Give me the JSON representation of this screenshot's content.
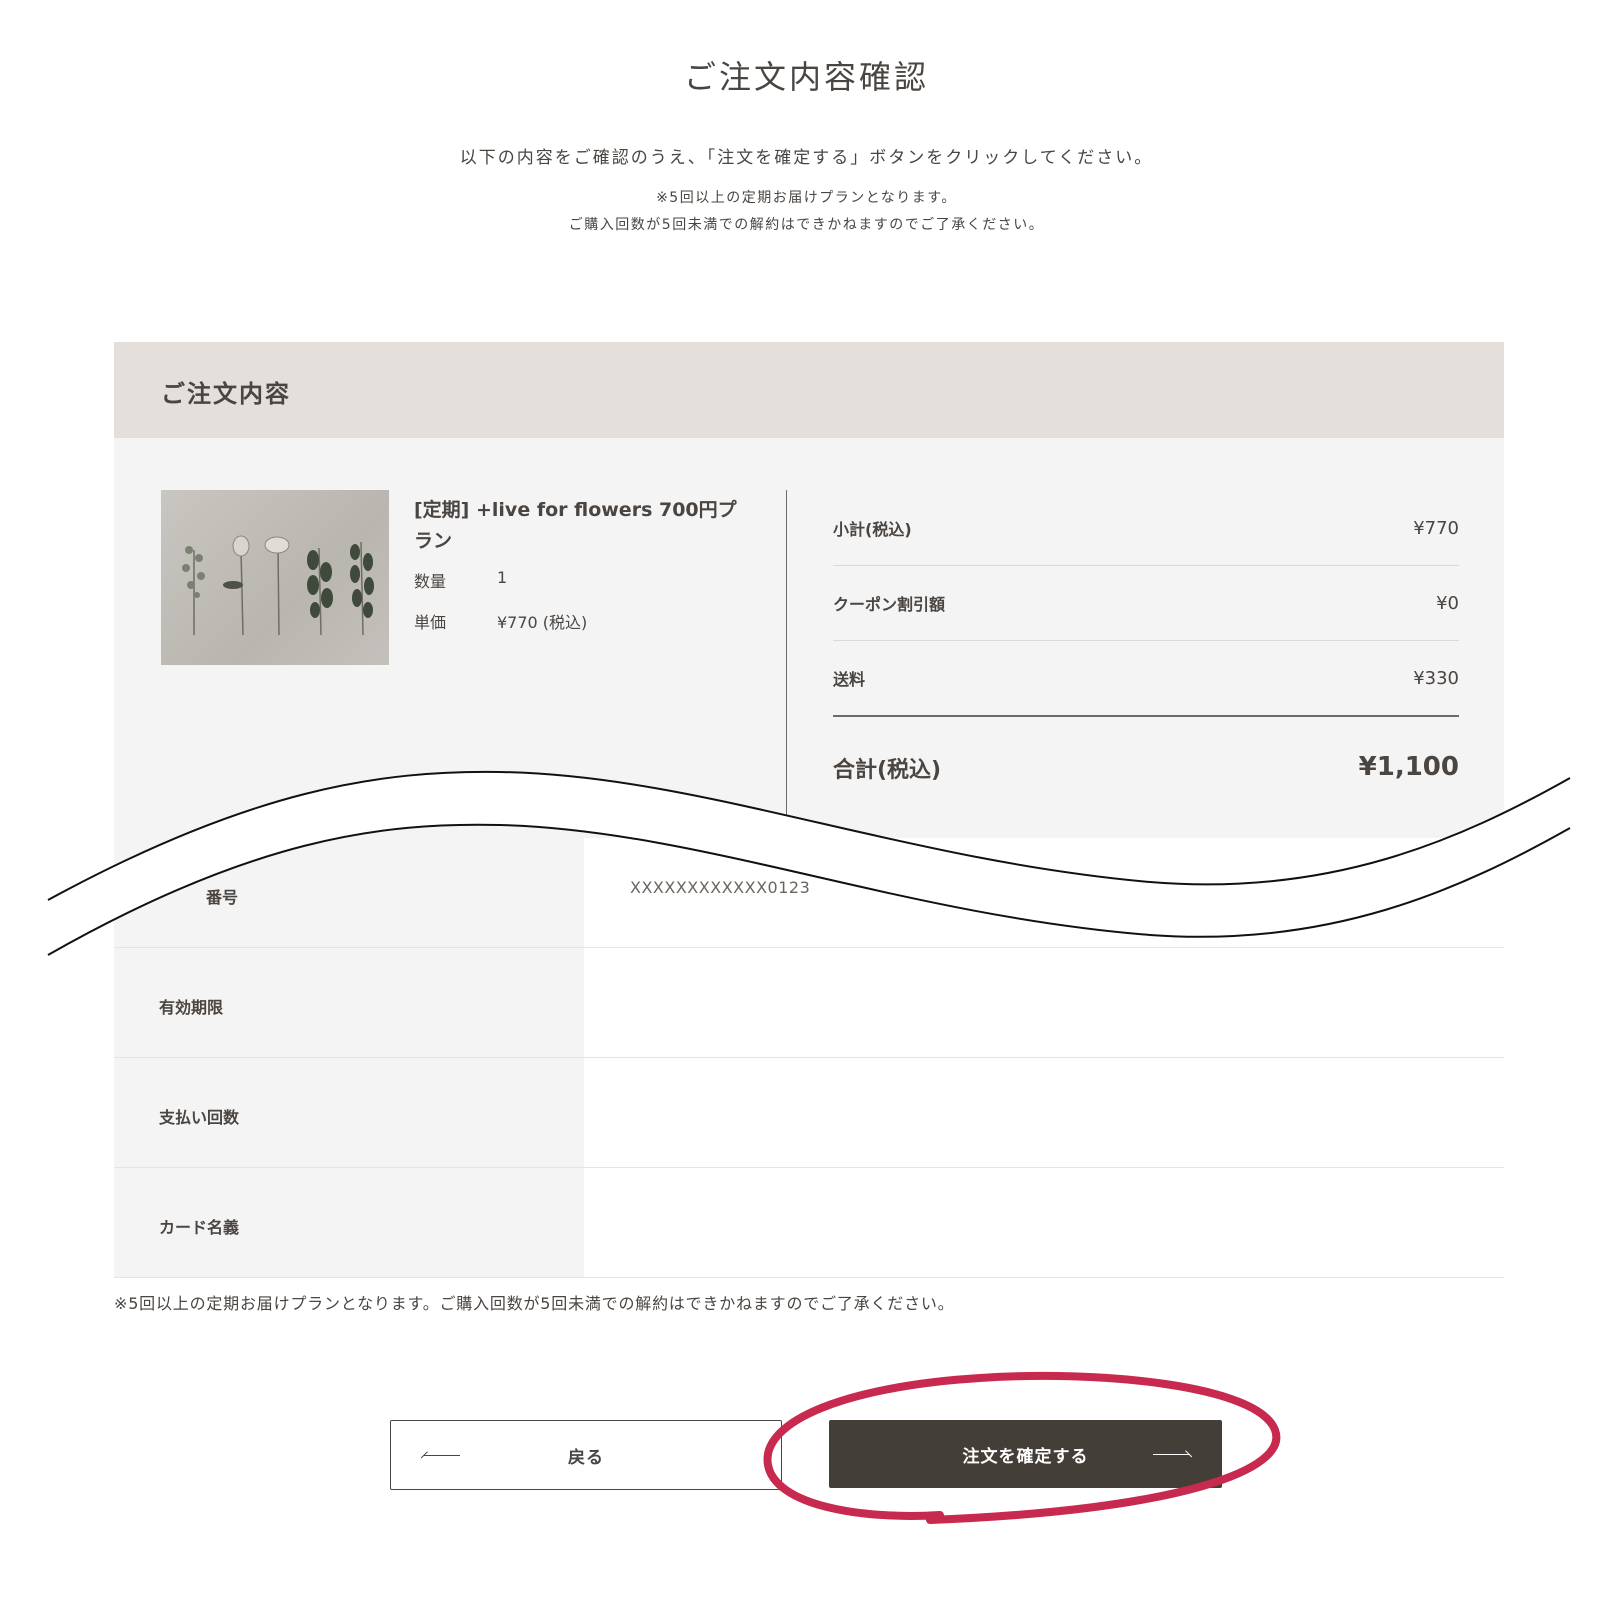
{
  "page": {
    "title": "ご注文内容確認",
    "intro": "以下の内容をご確認のうえ、「注文を確定する」ボタンをクリックしてください。",
    "notice_line1": "※5回以上の定期お届けプランとなります。",
    "notice_line2": "ご購入回数が5回未満での解約はできかねますのでご了承ください。"
  },
  "order": {
    "section_title": "ご注文内容",
    "product": {
      "name": "[定期] +live for flowers 700円プラン",
      "quantity_label": "数量",
      "quantity_value": "1",
      "unit_price_label": "単価",
      "unit_price_value": "¥770 (税込)"
    },
    "summary": {
      "subtotal_label": "小計(税込)",
      "subtotal_value": "¥770",
      "coupon_label": "クーポン割引額",
      "coupon_value": "¥0",
      "shipping_label": "送料",
      "shipping_value": "¥330",
      "total_label": "合計(税込)",
      "total_value": "¥1,100"
    }
  },
  "payment": {
    "card_number_label": "番号",
    "card_number_value": "XXXXXXXXXXXX0123",
    "expiry_label": "有効期限",
    "installments_label": "支払い回数",
    "card_holder_label": "カード名義"
  },
  "footer_note": "※5回以上の定期お届けプランとなります。ご購入回数が5回未満での解約はできかねますのでご了承ください。",
  "buttons": {
    "back_label": "戻る",
    "confirm_label": "注文を確定する"
  },
  "colors": {
    "header_bg": "#e5dfdc",
    "panel_bg": "#f5f4f4",
    "confirm_bg": "#433e38",
    "highlight": "#c8294f"
  },
  "icons": {
    "back": "arrow-left-icon",
    "confirm": "arrow-right-icon"
  }
}
